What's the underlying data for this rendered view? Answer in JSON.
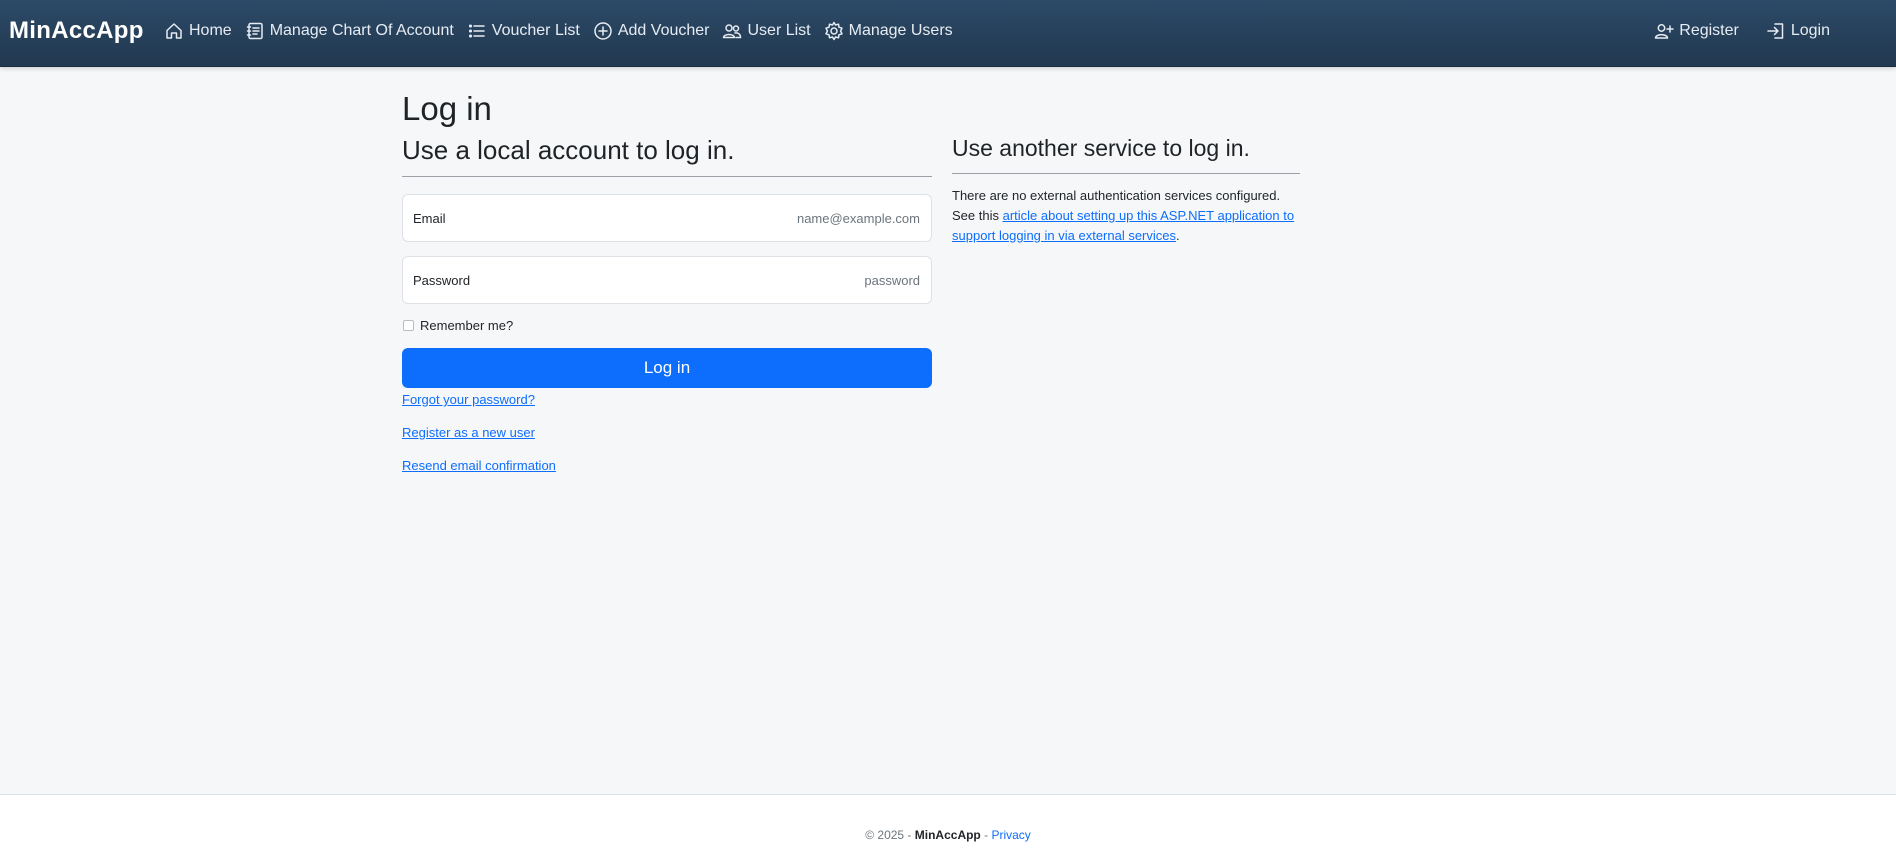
{
  "navbar": {
    "brand": "MinAccApp",
    "left_items": [
      {
        "label": "Home",
        "icon": "home-icon"
      },
      {
        "label": "Manage Chart Of Account",
        "icon": "journal-icon"
      },
      {
        "label": "Voucher List",
        "icon": "list-icon"
      },
      {
        "label": "Add Voucher",
        "icon": "plus-circle-icon"
      },
      {
        "label": "User List",
        "icon": "people-icon"
      },
      {
        "label": "Manage Users",
        "icon": "gear-icon"
      }
    ],
    "right_items": [
      {
        "label": "Register",
        "icon": "person-plus-icon"
      },
      {
        "label": "Login",
        "icon": "box-arrow-in-icon"
      }
    ],
    "background": "#2c4a68"
  },
  "page": {
    "title": "Log in",
    "local": {
      "heading": "Use a local account to log in.",
      "email": {
        "label": "Email",
        "placeholder": "name@example.com"
      },
      "password": {
        "label": "Password",
        "placeholder": "password"
      },
      "remember_label": "Remember me?",
      "login_button": "Log in",
      "forgot_link": "Forgot your password?",
      "register_link": "Register as a new user",
      "resend_link": "Resend email confirmation"
    },
    "external": {
      "heading": "Use another service to log in.",
      "text_line1": "There are no external authentication services configured.",
      "text_prefix": "See this ",
      "link_text": "article about setting up this ASP.NET application to support logging in via external services",
      "text_suffix": "."
    }
  },
  "footer": {
    "copyright": "© 2025 - ",
    "brand": "MinAccApp",
    "separator": " - ",
    "privacy": "Privacy"
  },
  "colors": {
    "primary": "#0d6efd",
    "navbar": "#2c4a68",
    "background": "#f6f7f9"
  }
}
